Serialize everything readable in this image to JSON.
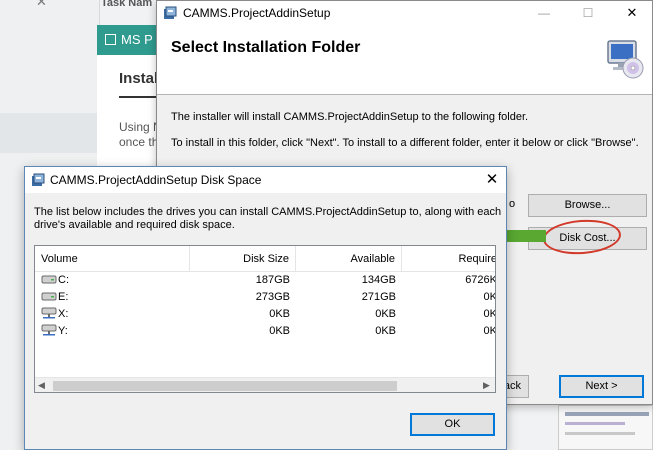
{
  "background": {
    "task_name_label": "Task Nam",
    "card_header": "MS P",
    "card_title": "Instal",
    "card_text_1": "Using N",
    "card_text_2": "once th"
  },
  "wizard": {
    "title": "CAMMS.ProjectAddinSetup",
    "heading": "Select Installation Folder",
    "text_1": "The installer will install CAMMS.ProjectAddinSetup to the following folder.",
    "text_2": "To install in this folder, click \"Next\". To install to a different folder, enter it below or click \"Browse\".",
    "partial_text": "o",
    "browse_label": "Browse...",
    "disk_cost_label": "Disk Cost...",
    "back_label": "ack",
    "next_label": "Next >",
    "highlight_color": "#d23a2a",
    "arrow_color": "#5aa832"
  },
  "disk_dialog": {
    "title": "CAMMS.ProjectAddinSetup Disk Space",
    "desc_1": "The list below includes the drives you can install CAMMS.ProjectAddinSetup to, along with each",
    "desc_2": "drive's available and required disk space.",
    "columns": {
      "volume": "Volume",
      "disk_size": "Disk Size",
      "available": "Available",
      "required": "Require"
    },
    "rows": [
      {
        "volume": "C:",
        "disk_size": "187GB",
        "available": "134GB",
        "required": "6726K",
        "icon": "local-drive-icon"
      },
      {
        "volume": "E:",
        "disk_size": "273GB",
        "available": "271GB",
        "required": "0K",
        "icon": "local-drive-icon"
      },
      {
        "volume": "X:",
        "disk_size": "0KB",
        "available": "0KB",
        "required": "0K",
        "icon": "network-drive-icon"
      },
      {
        "volume": "Y:",
        "disk_size": "0KB",
        "available": "0KB",
        "required": "0K",
        "icon": "network-drive-icon"
      }
    ],
    "ok_label": "OK"
  }
}
